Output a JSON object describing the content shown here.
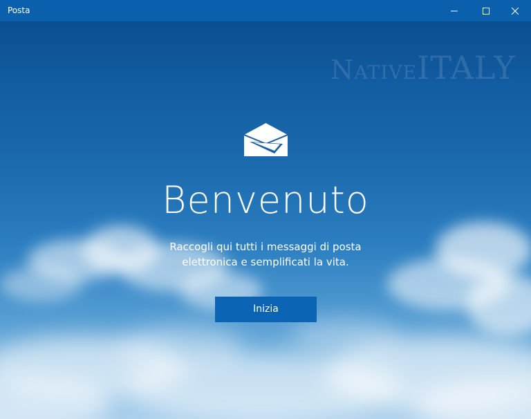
{
  "window": {
    "title": "Posta",
    "controls": {
      "minimize_icon": "minimize-icon",
      "maximize_icon": "maximize-icon",
      "close_icon": "close-icon"
    }
  },
  "watermark": {
    "part1": "Native",
    "part2": "ITALY"
  },
  "welcome": {
    "icon": "mail-icon",
    "title": "Benvenuto",
    "subtitle_line1": "Raccogli qui tutti i messaggi di posta",
    "subtitle_line2": "elettronica e semplificati la vita.",
    "button_label": "Inizia"
  },
  "colors": {
    "titlebar": "#0a60ad",
    "button": "#0b63b4",
    "sky_top": "#0b4e92",
    "sky_bottom": "#a7cdea"
  }
}
